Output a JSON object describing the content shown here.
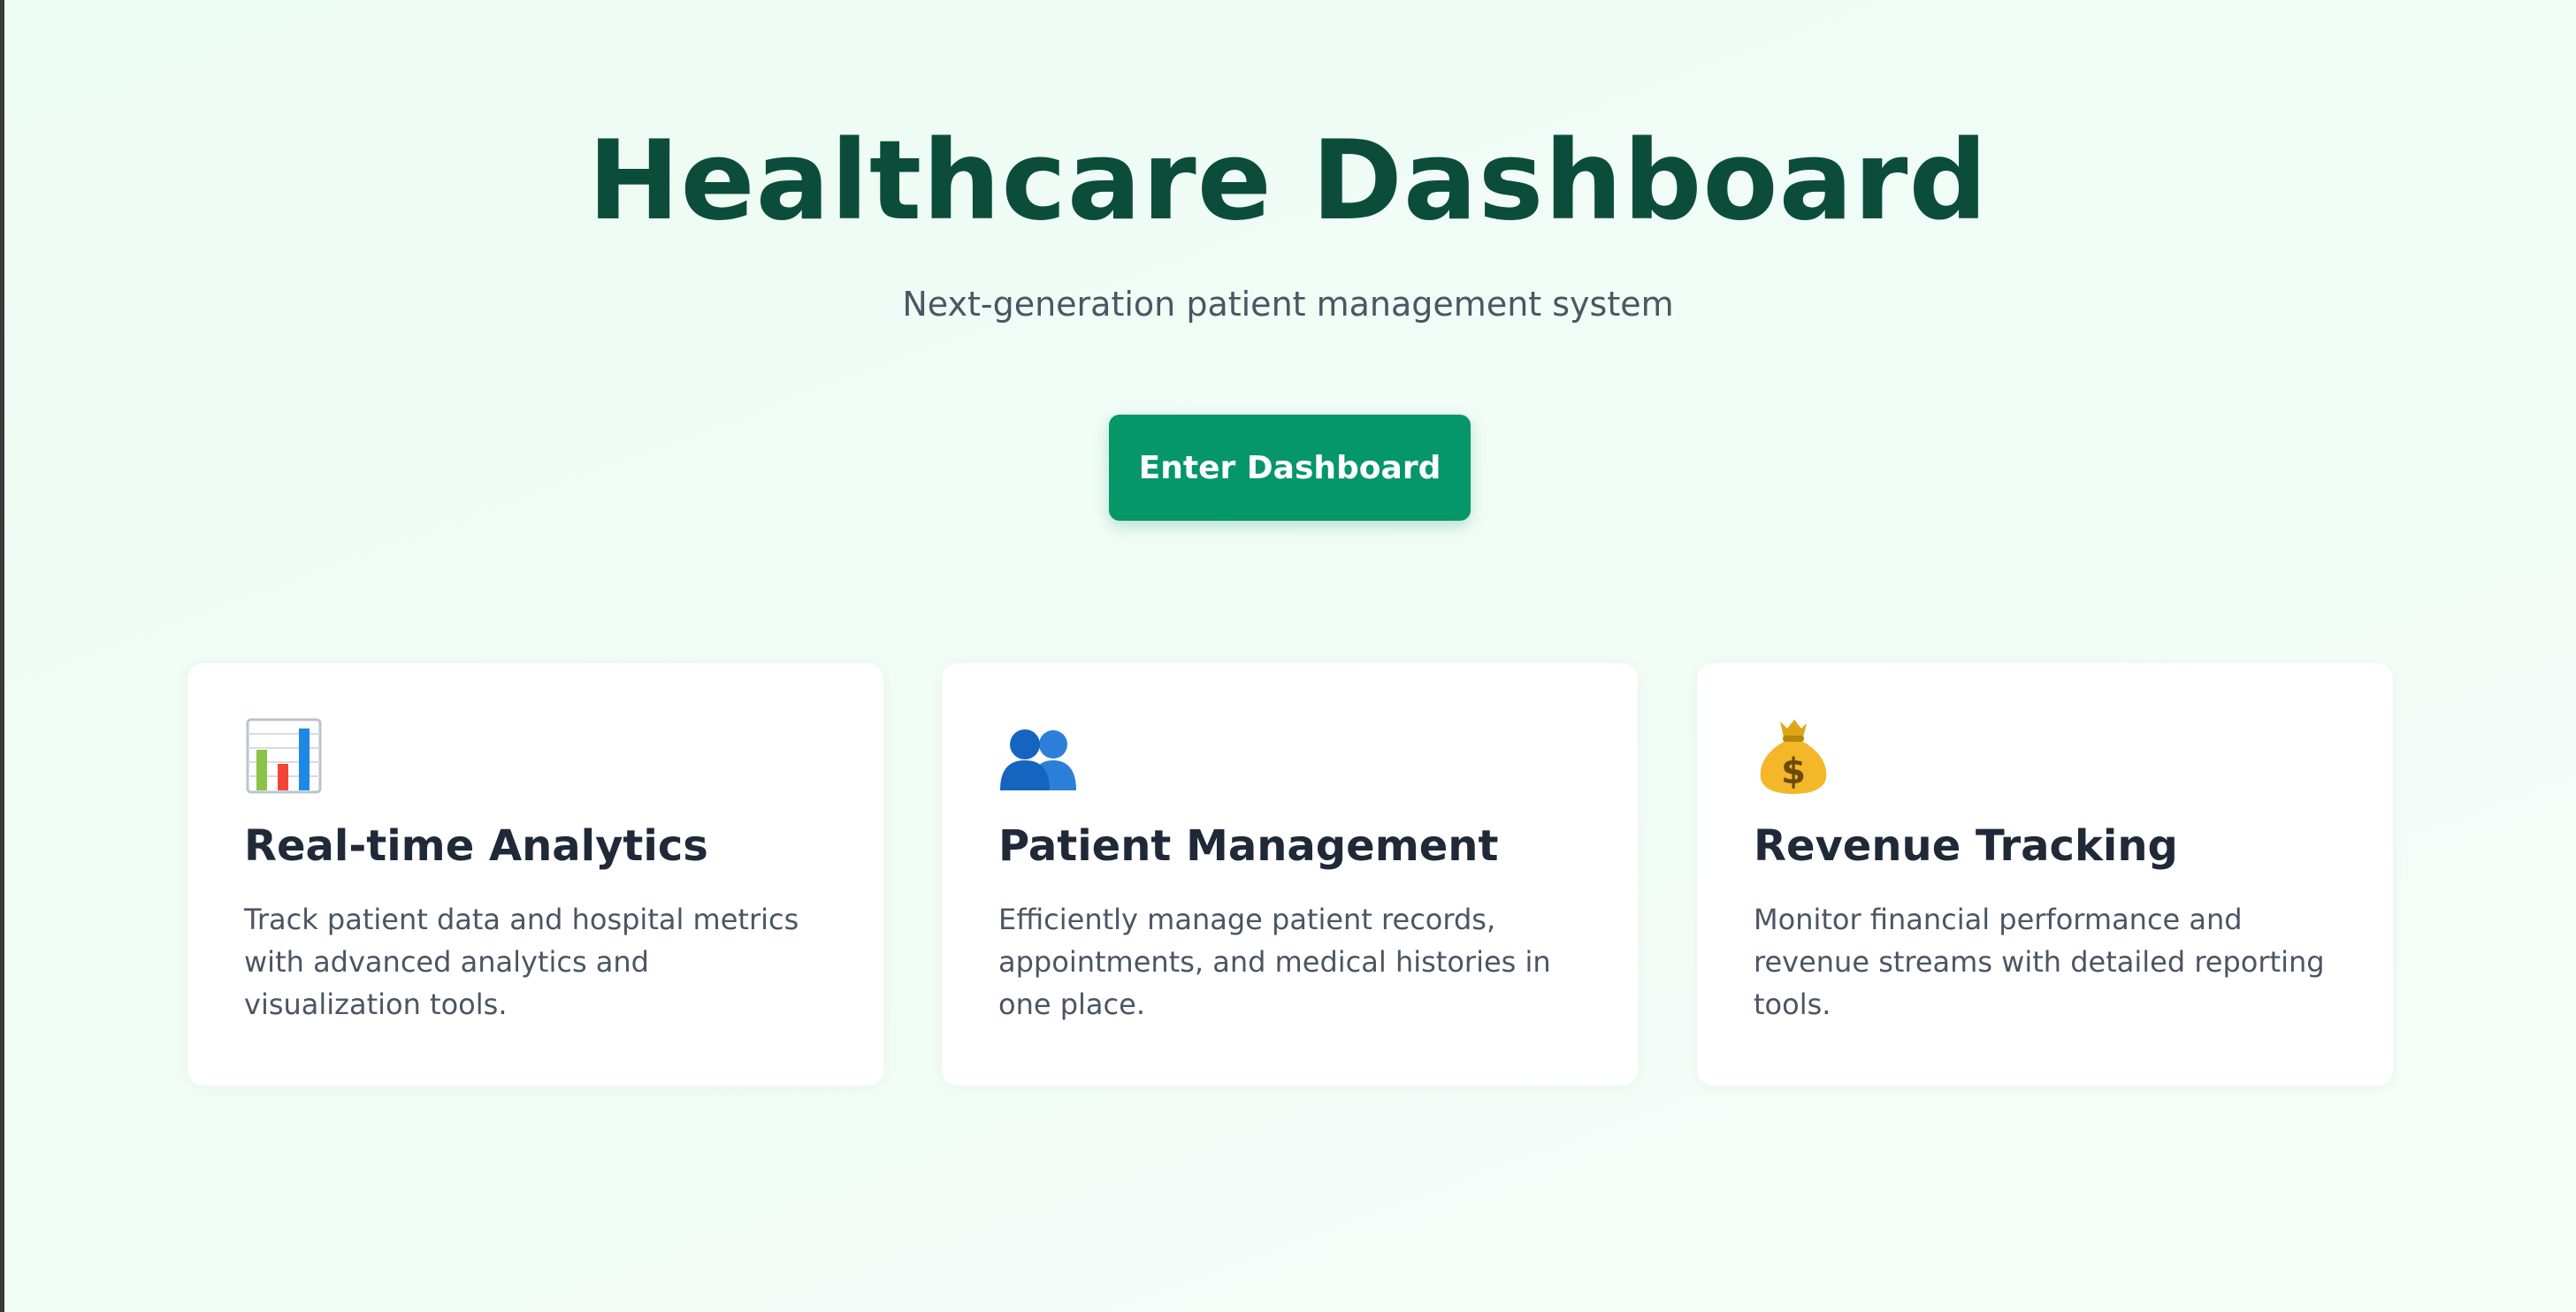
{
  "hero": {
    "title": "Healthcare Dashboard",
    "subtitle": "Next-generation patient management system",
    "cta_label": "Enter Dashboard"
  },
  "features": [
    {
      "icon": "bar-chart-icon",
      "title": "Real-time Analytics",
      "description": "Track patient data and hospital metrics with advanced analytics and visualization tools."
    },
    {
      "icon": "users-icon",
      "title": "Patient Management",
      "description": "Efficiently manage patient records, appointments, and medical histories in one place."
    },
    {
      "icon": "money-bag-icon",
      "title": "Revenue Tracking",
      "description": "Monitor financial performance and revenue streams with detailed reporting tools."
    }
  ],
  "colors": {
    "title": "#0b4d3a",
    "subtitle": "#4b5563",
    "button_bg": "#059669",
    "button_text": "#ffffff"
  }
}
